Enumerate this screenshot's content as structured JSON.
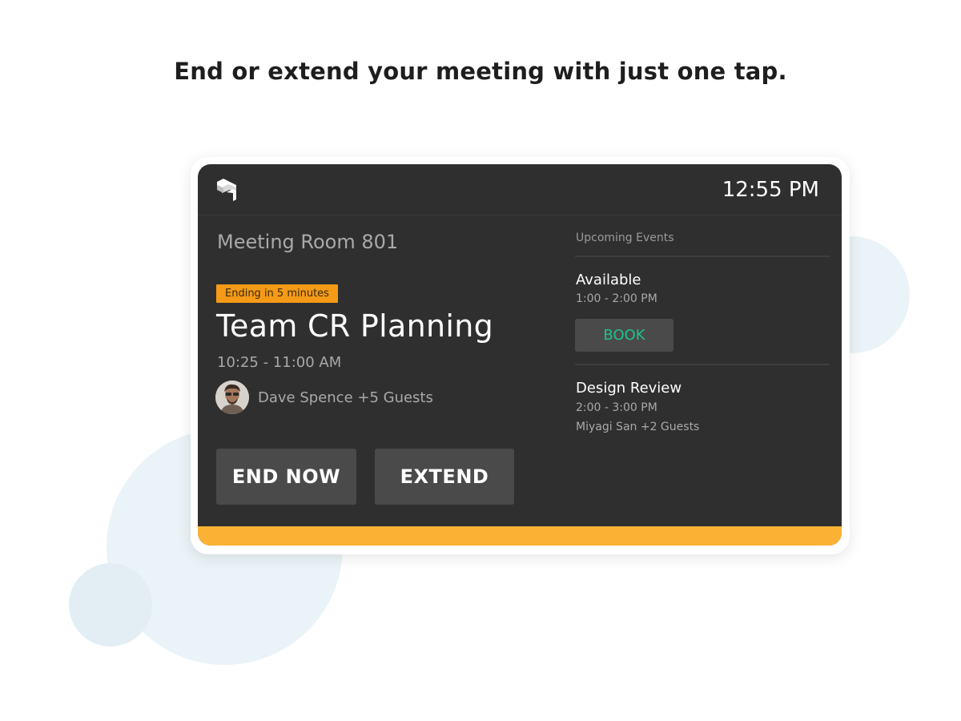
{
  "headline": "End or extend your meeting with just one tap.",
  "colors": {
    "screen_bg": "#2f2f2f",
    "badge": "#f59a17",
    "status_bar": "#fbb234",
    "book_text": "#1fc28a",
    "button_bg": "#4a4a4a"
  },
  "device": {
    "logo_icon": "stacked-logo-icon",
    "clock": "12:55 PM",
    "room_name": "Meeting Room 801",
    "current_meeting": {
      "badge": "Ending in 5 minutes",
      "title": "Team CR Planning",
      "time": "10:25 - 11:00 AM",
      "host": "Dave Spence +5 Guests",
      "avatar_icon": "user-avatar"
    },
    "actions": {
      "end_now": "END NOW",
      "extend": "EXTEND"
    },
    "upcoming": {
      "label": "Upcoming Events",
      "events": [
        {
          "title": "Available",
          "time": "1:00 - 2:00 PM",
          "action": "BOOK"
        },
        {
          "title": "Design Review",
          "time": "2:00  - 3:00 PM",
          "guests": "Miyagi San +2 Guests"
        }
      ]
    }
  }
}
